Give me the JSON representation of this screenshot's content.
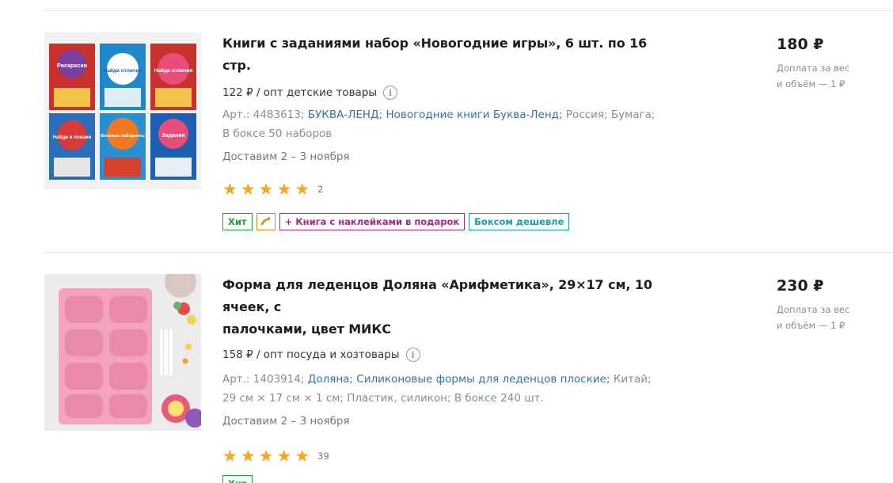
{
  "products": [
    {
      "title": "Книги с заданиями набор «Новогодние игры», 6 шт. по 16 стр.",
      "opt_price": "122 ₽ / опт детские товары",
      "article": "Арт.: 4483613;",
      "brand": "БУКВА-ЛЕНД;",
      "category": "Новогодние книги Буква-Ленд;",
      "country": "Россия;",
      "material": "Бумага;",
      "box": "В боксе 50 наборов",
      "delivery": "Доставим 2 – 3 ноября",
      "rating_count": "2",
      "price": "180 ₽",
      "surcharge_line1": "Доплата за вес",
      "surcharge_line2": "и объём — 1 ₽",
      "badges": {
        "hit": "Хит",
        "gift": "+ Книга с наклейками в подарок",
        "box": "Боксом дешевле"
      },
      "book_titles": [
        "Раскраски",
        "Найди отличия",
        "Найди отличия",
        "Найди и покажи",
        "Весёлые лабиринты",
        "Задания"
      ]
    },
    {
      "title_line1": "Форма для леденцов Доляна «Арифметика», 29×17 см, 10 ячеек, с",
      "title_line2": "палочками, цвет МИКС",
      "opt_price": "158 ₽ / опт посуда и хозтовары",
      "article": "Арт.: 1403914;",
      "brand": "Доляна;",
      "category": "Силиконовые формы для леденцов плоские;",
      "country": "Китай;",
      "size": "29 см × 17 см × 1 см;",
      "material": "Пластик, силикон;",
      "box": "В боксе 240 шт.",
      "delivery": "Доставим 2 – 3 ноября",
      "rating_count": "39",
      "price": "230 ₽",
      "surcharge_line1": "Доплата за вес",
      "surcharge_line2": "и объём — 1 ₽",
      "badges": {
        "hit": "Хит"
      }
    }
  ],
  "icons": {
    "star": "star-icon",
    "info": "info-icon",
    "dolphin": "dolphin-icon"
  },
  "colors": {
    "star": "#f5a623",
    "link": "#3c6fa8",
    "badge_hit": "#1f9e39",
    "badge_gift": "#9b2a8d",
    "badge_box": "#1b9ab0",
    "badge_dolphin": "#d88a1a",
    "mold_pink": "#f4a3bd"
  }
}
